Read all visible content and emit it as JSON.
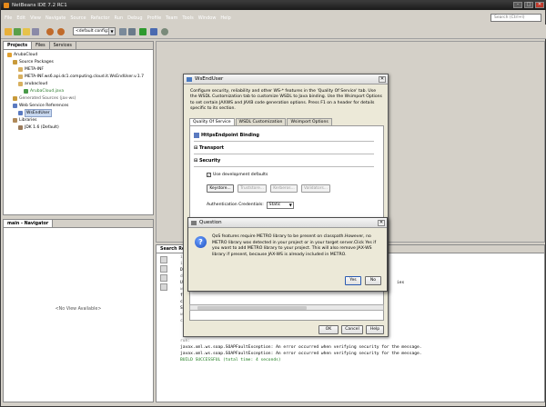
{
  "window": {
    "title": "NetBeans IDE 7.2 RC1",
    "controls": [
      "–",
      "□",
      "✕"
    ]
  },
  "menu": [
    "File",
    "Edit",
    "View",
    "Navigate",
    "Source",
    "Refactor",
    "Run",
    "Debug",
    "Profile",
    "Team",
    "Tools",
    "Window",
    "Help"
  ],
  "search": {
    "placeholder": "Search (Ctrl+I)"
  },
  "toolbar": {
    "config": "<default config>"
  },
  "projects_panel": {
    "tabs": [
      "Projects",
      "Files",
      "Services"
    ],
    "tree": [
      "ArubaCloud",
      "Source Packages",
      "META-INF",
      "META-INF.ws6.api.dc1.computing.cloud.it.WsEndUser.v.1.7",
      "arubacloud",
      "ArubaCloud.java",
      "Generated Sources (jax-ws)",
      "Web Service References",
      "WsEndUser",
      "Libraries",
      "JDK 1.6 (Default)"
    ]
  },
  "navigator": {
    "title": "main - Navigator",
    "empty": "<No View Available>"
  },
  "output": {
    "title": "Search Results",
    "lines": [
      "init:",
      "init:",
      "Deleting:",
      "deps-jar:",
      "Updating p",
      "wsimport-",
      "files are",
      "classLoade",
      "SharedReso",
      "wsimport-",
      "compile:",
      "run:",
      "javax.xml.ws.soap.SOAPFaultException: An error occurred when verifying security for the message.",
      "javax.xml.ws.soap.SOAPFaultException: An error occurred when verifying security for the message.",
      "BUILD SUCCESSFUL (total time: 4 seconds)"
    ],
    "truncated_suffix": "ies"
  },
  "wsdl_dialog": {
    "title": "WsEndUser",
    "description": "Configure security, reliability and other WS-* features in the 'Quality Of Service' tab. Use the WSDL Customization tab to customize WSDL to Java binding. Use the Wsimport Options to set certain JAXWS and JAXB code generation options. Press F1 on a header for details specific to its section.",
    "tabs": [
      "Quality Of Service",
      "WSDL Customization",
      "Wsimport Options"
    ],
    "binding": "HttpsEndpoint Binding",
    "transport": "Transport",
    "security": "Security",
    "use_dev_defaults": "Use development defaults",
    "buttons_row": [
      "Keystore...",
      "Truststore...",
      "Kerberos...",
      "Validators..."
    ],
    "auth_label": "Authentication Credentials:",
    "auth_value": "Static",
    "ok": "OK",
    "cancel": "Cancel",
    "help": "Help"
  },
  "question_dialog": {
    "title": "Question",
    "message": "QoS features require METRO library to be present on classpath.However, no METRO library was detected in your project or in your target server.Click Yes if you want to add METRO library to your project. This will also remove JAX-WS library if present, because JAX-WS is already included in METRO.",
    "yes": "Yes",
    "no": "No"
  },
  "colors": {
    "title_bar": "#1a1a1a",
    "chrome": "#d4d0c8",
    "dialog": "#ece9d8",
    "build_ok": "#1a7a1a",
    "question_icon": "#1f4fbf"
  }
}
